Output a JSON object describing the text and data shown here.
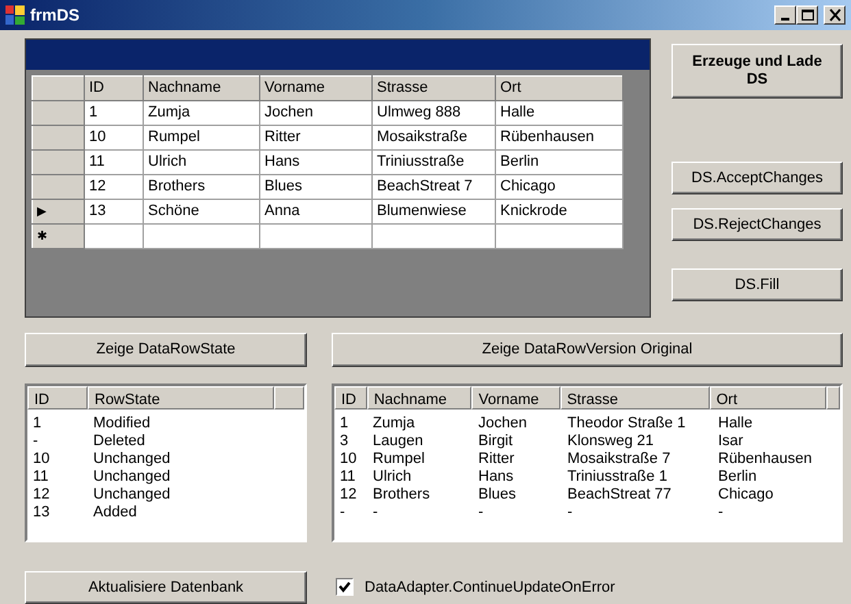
{
  "window": {
    "title": "frmDS"
  },
  "grid": {
    "columns": [
      "ID",
      "Nachname",
      "Vorname",
      "Strasse",
      "Ort"
    ],
    "rows": [
      {
        "cells": [
          "1",
          "Zumja",
          "Jochen",
          "Ulmweg 888",
          "Halle"
        ]
      },
      {
        "cells": [
          "10",
          "Rumpel",
          "Ritter",
          "Mosaikstraße",
          "Rübenhausen"
        ]
      },
      {
        "cells": [
          "11",
          "Ulrich",
          "Hans",
          "Triniusstraße",
          "Berlin"
        ]
      },
      {
        "cells": [
          "12",
          "Brothers",
          "Blues",
          "BeachStreat 7",
          "Chicago"
        ]
      },
      {
        "indicator": "▶",
        "cells": [
          "13",
          "Schöne",
          "Anna",
          "Blumenwiese",
          "Knickrode"
        ]
      },
      {
        "indicator": "✱",
        "cells": []
      }
    ]
  },
  "side_buttons": [
    {
      "label": "Erzeuge und Lade DS",
      "bold": true
    },
    {
      "label": "DS.AcceptChanges",
      "bold": false
    },
    {
      "label": "DS.RejectChanges",
      "bold": false
    },
    {
      "label": "DS.Fill",
      "bold": false
    }
  ],
  "state_button": {
    "label": "Zeige DataRowState"
  },
  "version_button": {
    "label": "Zeige DataRowVersion Original"
  },
  "state_list": {
    "columns": [
      "ID",
      "RowState"
    ],
    "rows": [
      [
        "1",
        "Modified"
      ],
      [
        "-",
        "Deleted"
      ],
      [
        "10",
        "Unchanged"
      ],
      [
        "11",
        "Unchanged"
      ],
      [
        "12",
        "Unchanged"
      ],
      [
        "13",
        "Added"
      ]
    ]
  },
  "version_list": {
    "columns": [
      "ID",
      "Nachname",
      "Vorname",
      "Strasse",
      "Ort"
    ],
    "rows": [
      [
        "1",
        "Zumja",
        "Jochen",
        "Theodor Straße 1",
        "Halle"
      ],
      [
        "3",
        "Laugen",
        "Birgit",
        "Klonsweg 21",
        "Isar"
      ],
      [
        "10",
        "Rumpel",
        "Ritter",
        "Mosaikstraße 7",
        "Rübenhausen"
      ],
      [
        "11",
        "Ulrich",
        "Hans",
        "Triniusstraße 1",
        "Berlin"
      ],
      [
        "12",
        "Brothers",
        "Blues",
        "BeachStreat 77",
        "Chicago"
      ],
      [
        "-",
        "-",
        "-",
        "-",
        "-"
      ]
    ]
  },
  "update_button": {
    "label": "Aktualisiere Datenbank"
  },
  "continue_checkbox": {
    "label": "DataAdapter.ContinueUpdateOnError",
    "checked": true
  }
}
